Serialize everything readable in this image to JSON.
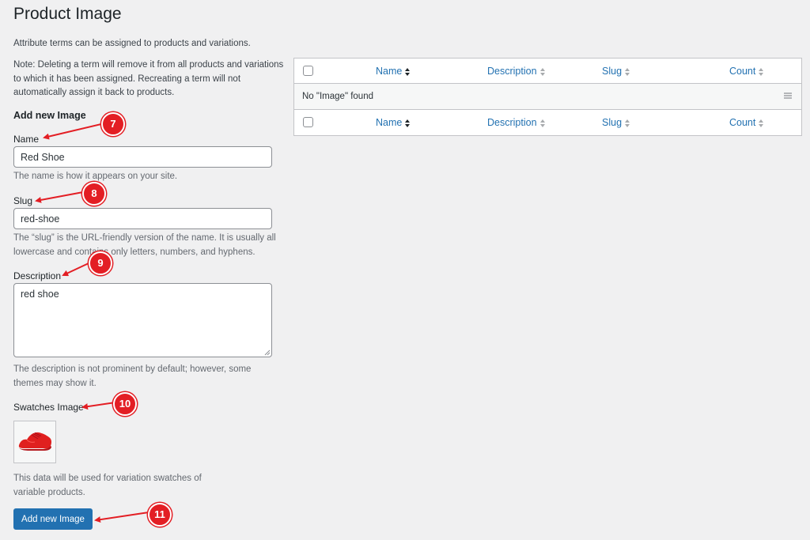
{
  "page": {
    "title": "Product Image",
    "intro": "Attribute terms can be assigned to products and variations.",
    "note": "Note: Deleting a term will remove it from all products and variations to which it has been assigned. Recreating a term will not automatically assign it back to products."
  },
  "form": {
    "heading": "Add new Image",
    "name": {
      "label": "Name",
      "value": "Red Shoe",
      "help": "The name is how it appears on your site."
    },
    "slug": {
      "label": "Slug",
      "value": "red-shoe",
      "help": "The “slug” is the URL-friendly version of the name. It is usually all lowercase and contains only letters, numbers, and hyphens."
    },
    "description": {
      "label": "Description",
      "value": "red shoe",
      "help": "The description is not prominent by default; however, some themes may show it."
    },
    "swatch": {
      "label": "Swatches Image",
      "image": "red-shoe-image",
      "help": "This data will be used for variation swatches of variable products."
    },
    "submit_label": "Add new Image"
  },
  "table": {
    "columns": [
      "Name",
      "Description",
      "Slug",
      "Count"
    ],
    "empty_message": "No \"Image\" found",
    "sort_icon": "sort-arrows-icon",
    "row_menu_icon": "hamburger-icon"
  },
  "annotations": [
    "7",
    "8",
    "9",
    "10",
    "11"
  ],
  "colors": {
    "background": "#f0f0f1",
    "primary_button": "#2271b1",
    "link": "#2271b1",
    "annotation": "#e31e24",
    "shoe": "#e0201f"
  }
}
